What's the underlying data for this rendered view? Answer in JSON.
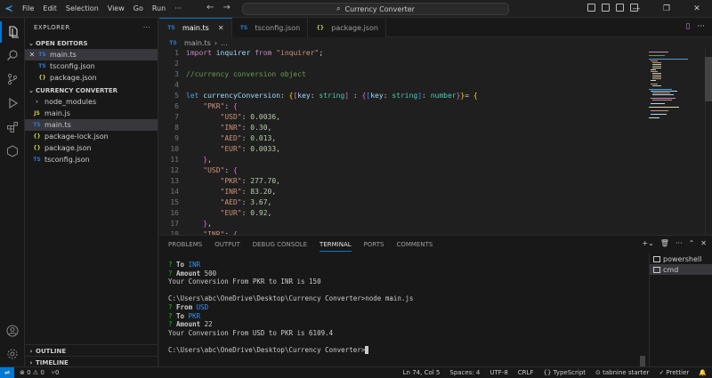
{
  "window": {
    "title": "Currency Converter",
    "menu": [
      "File",
      "Edit",
      "Selection",
      "View",
      "Go",
      "Run",
      "···"
    ]
  },
  "sidebar": {
    "title": "EXPLORER",
    "open_editors_label": "OPEN EDITORS",
    "open_editors": [
      {
        "name": "main.ts",
        "icon": "TS",
        "type": "ts"
      },
      {
        "name": "tsconfig.json",
        "icon": "TS",
        "type": "ts"
      },
      {
        "name": "package.json",
        "icon": "{}",
        "type": "json"
      }
    ],
    "project_label": "CURRENCY CONVERTER",
    "files": [
      {
        "name": "node_modules",
        "icon": "›",
        "type": "folder"
      },
      {
        "name": "main.js",
        "icon": "JS",
        "type": "js"
      },
      {
        "name": "main.ts",
        "icon": "TS",
        "type": "ts"
      },
      {
        "name": "package-lock.json",
        "icon": "{}",
        "type": "json"
      },
      {
        "name": "package.json",
        "icon": "{}",
        "type": "json"
      },
      {
        "name": "tsconfig.json",
        "icon": "TS",
        "type": "ts"
      }
    ],
    "outline_label": "OUTLINE",
    "timeline_label": "TIMELINE"
  },
  "tabs": [
    {
      "name": "main.ts",
      "icon": "TS"
    },
    {
      "name": "tsconfig.json",
      "icon": "TS"
    },
    {
      "name": "package.json",
      "icon": "{}"
    }
  ],
  "breadcrumb": {
    "icon": "TS",
    "file": "main.ts",
    "sep": "›",
    "more": "..."
  },
  "editor": {
    "line_numbers": [
      "1",
      "2",
      "3",
      "4",
      "5",
      "6",
      "7",
      "8",
      "9",
      "10",
      "11",
      "12",
      "13",
      "14",
      "15",
      "16",
      "17",
      "18",
      "19"
    ]
  },
  "panel": {
    "tabs": [
      "PROBLEMS",
      "OUTPUT",
      "DEBUG CONSOLE",
      "TERMINAL",
      "PORTS",
      "COMMENTS"
    ],
    "active_tab": "TERMINAL",
    "terminals": [
      "powershell",
      "cmd"
    ],
    "terminal_lines": [
      {
        "prompt": "? ",
        "label": "To ",
        "answer": "INR"
      },
      {
        "prompt": "? ",
        "label": "Amount ",
        "answer": "500"
      },
      {
        "text": "Your Conversion From PKR to INR is 150"
      },
      {
        "text": ""
      },
      {
        "text": "C:\\Users\\abc\\OneDrive\\Desktop\\Currency Converter>node main.js"
      },
      {
        "prompt": "? ",
        "label": "From ",
        "answer": "USD"
      },
      {
        "prompt": "? ",
        "label": "To ",
        "answer": "PKR"
      },
      {
        "prompt": "? ",
        "label": "Amount ",
        "answer": "22"
      },
      {
        "text": "Your Conversion From USD to PKR is 6109.4"
      },
      {
        "text": ""
      },
      {
        "text": "C:\\Users\\abc\\OneDrive\\Desktop\\Currency Converter>"
      }
    ]
  },
  "status": {
    "errors": "0",
    "warnings": "0",
    "ports": "0",
    "position": "Ln 74, Col 5",
    "spaces": "Spaces: 4",
    "encoding": "UTF-8",
    "eol": "CRLF",
    "language": "TypeScript",
    "tabnine": "tabnine starter",
    "prettier": "Prettier"
  },
  "colors": {
    "accent": "#0078d4",
    "background": "#1f1f1f",
    "sidebar": "#181818"
  }
}
